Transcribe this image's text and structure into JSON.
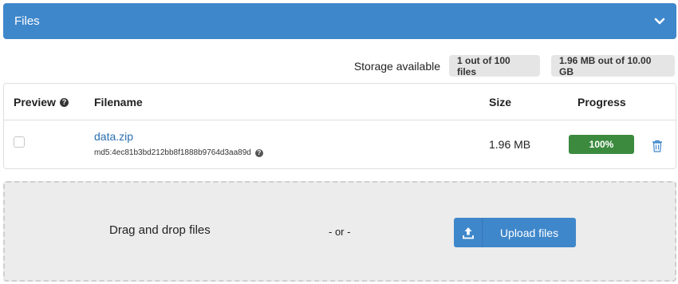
{
  "panel": {
    "title": "Files",
    "toggle_icon": "chevron-down-icon"
  },
  "storage": {
    "label": "Storage available",
    "files_badge": "1 out of 100 files",
    "size_badge": "1.96 MB out of 10.00 GB"
  },
  "table": {
    "headers": {
      "preview": "Preview",
      "filename": "Filename",
      "size": "Size",
      "progress": "Progress"
    },
    "rows": [
      {
        "filename": "data.zip",
        "checksum": "md5:4ec81b3bd212bb8f1888b9764d3aa89d",
        "size": "1.96 MB",
        "progress_label": "100%",
        "progress_value": 1.0
      }
    ]
  },
  "dropzone": {
    "drag_text": "Drag and drop files",
    "or_text": "- or -",
    "upload_label": "Upload files"
  },
  "colors": {
    "primary": "#3f87cb",
    "success": "#3b8a3e",
    "link": "#2a6fb0",
    "badge_bg": "#e5e5e5"
  }
}
